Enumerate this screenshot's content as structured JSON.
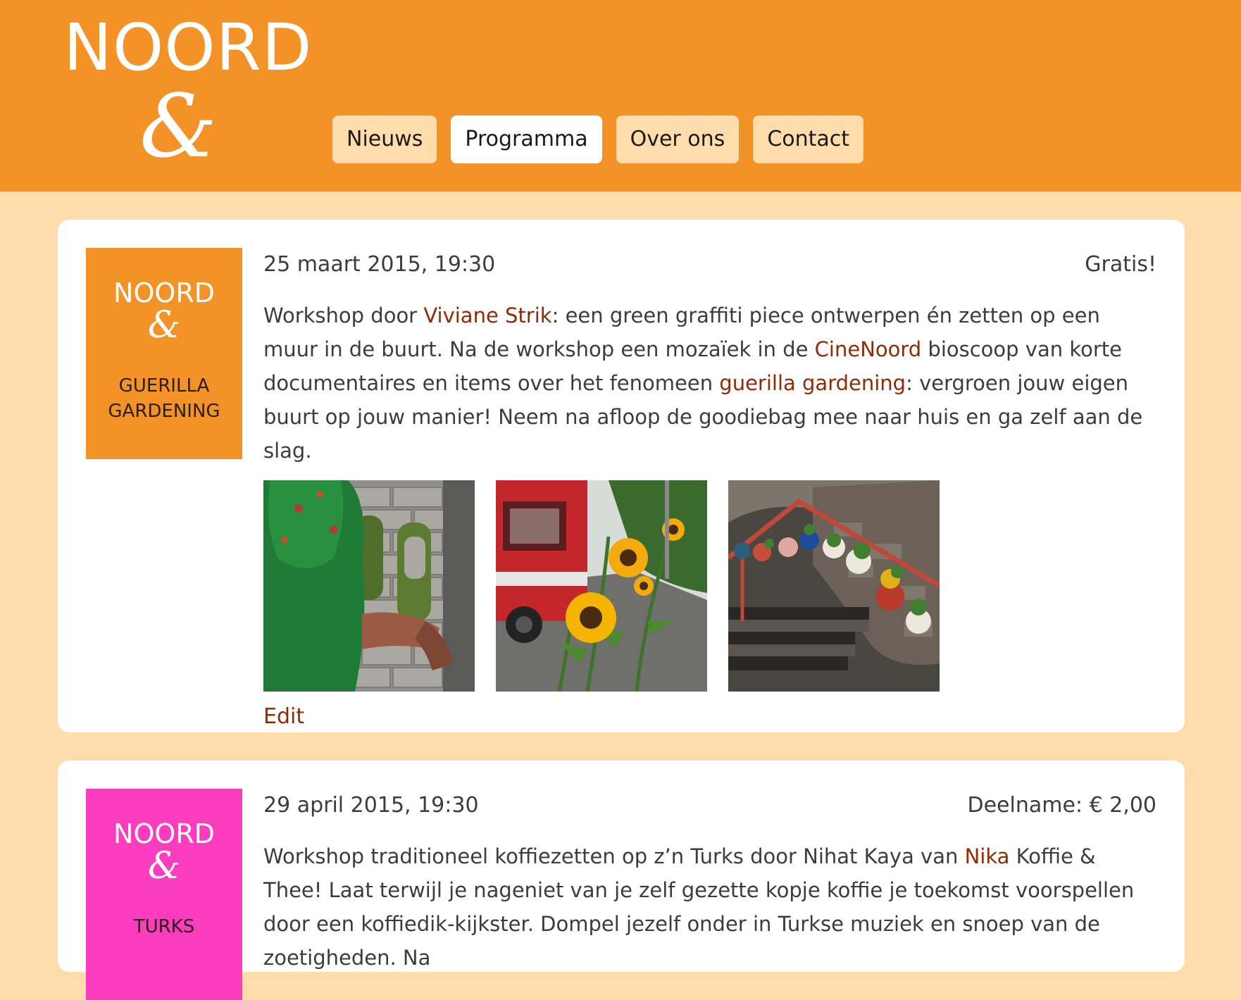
{
  "header": {
    "logo_word": "NOORD",
    "logo_amp": "&"
  },
  "nav": {
    "items": [
      {
        "label": "Nieuws",
        "active": false
      },
      {
        "label": "Programma",
        "active": true
      },
      {
        "label": "Over ons",
        "active": false
      },
      {
        "label": "Contact",
        "active": false
      }
    ]
  },
  "events": [
    {
      "poster": {
        "word": "NOORD",
        "amp": "&",
        "subtitle_line1": "GUERILLA",
        "subtitle_line2": "GARDENING",
        "color": "#f29227"
      },
      "date": "25 maart 2015, 19:30",
      "price": "Gratis!",
      "description": {
        "t1": "Workshop  door ",
        "link1": "Viviane Strik",
        "t2": ": een green graffiti piece ontwerpen én zetten op een muur in de buurt. Na de workshop een mozaïek in de ",
        "link2": "CineNoord",
        "t3": " bioscoop van korte documentaires en items over het fenomeen ",
        "link3": "guerilla gardening",
        "t4": ": vergroen jouw eigen buurt op jouw manier! Neem na afloop de goodiebag mee naar huis en ga zelf aan de slag."
      },
      "photos": [
        "green-graffiti-photo",
        "sunflowers-street-photo",
        "teapot-planters-stairs-photo"
      ],
      "edit_label": "Edit"
    },
    {
      "poster": {
        "word": "NOORD",
        "amp": "&",
        "subtitle_line1": "TURKS",
        "color": "#fa3cbf"
      },
      "date": "29 april 2015, 19:30",
      "price": "Deelname: € 2,00",
      "description": {
        "t1": "Workshop traditioneel koffiezetten op z’n Turks door Nihat Kaya van ",
        "link1": "Nika",
        "t2": " Koffie & Thee! Laat terwijl je nageniet van je zelf gezette kopje koffie je toekomst voorspellen door een koffiedik-kijkster. Dompel jezelf onder in Turkse muziek en snoep van de zoetigheden. Na"
      }
    }
  ],
  "colors": {
    "header_bg": "#f29227",
    "page_bg": "#fedcab",
    "link": "#8f2b06",
    "card_bg": "#ffffff"
  }
}
